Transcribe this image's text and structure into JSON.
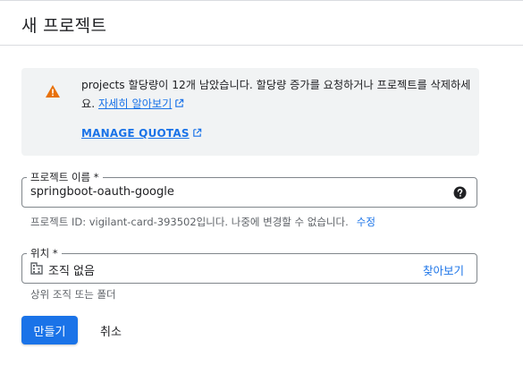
{
  "header": {
    "title": "새 프로젝트"
  },
  "quota_notice": {
    "message": "projects 할당량이 12개 남았습니다. 할당량 증가를 요청하거나 프로젝트를 삭제하세요.",
    "learn_more": "자세히 알아보기",
    "manage_quotas": "MANAGE QUOTAS",
    "warning_color": "#e8710a"
  },
  "project_name": {
    "label": "프로젝트 이름 *",
    "value": "springboot-oauth-google"
  },
  "project_id_hint": {
    "text": "프로젝트 ID: vigilant-card-393502입니다. 나중에 변경할 수 없습니다.",
    "edit_label": "수정"
  },
  "location": {
    "label": "위치 *",
    "value": "조직 없음",
    "browse_label": "찾아보기",
    "hint": "상위 조직 또는 폴더"
  },
  "actions": {
    "create_label": "만들기",
    "cancel_label": "취소",
    "primary_color": "#1a73e8"
  }
}
